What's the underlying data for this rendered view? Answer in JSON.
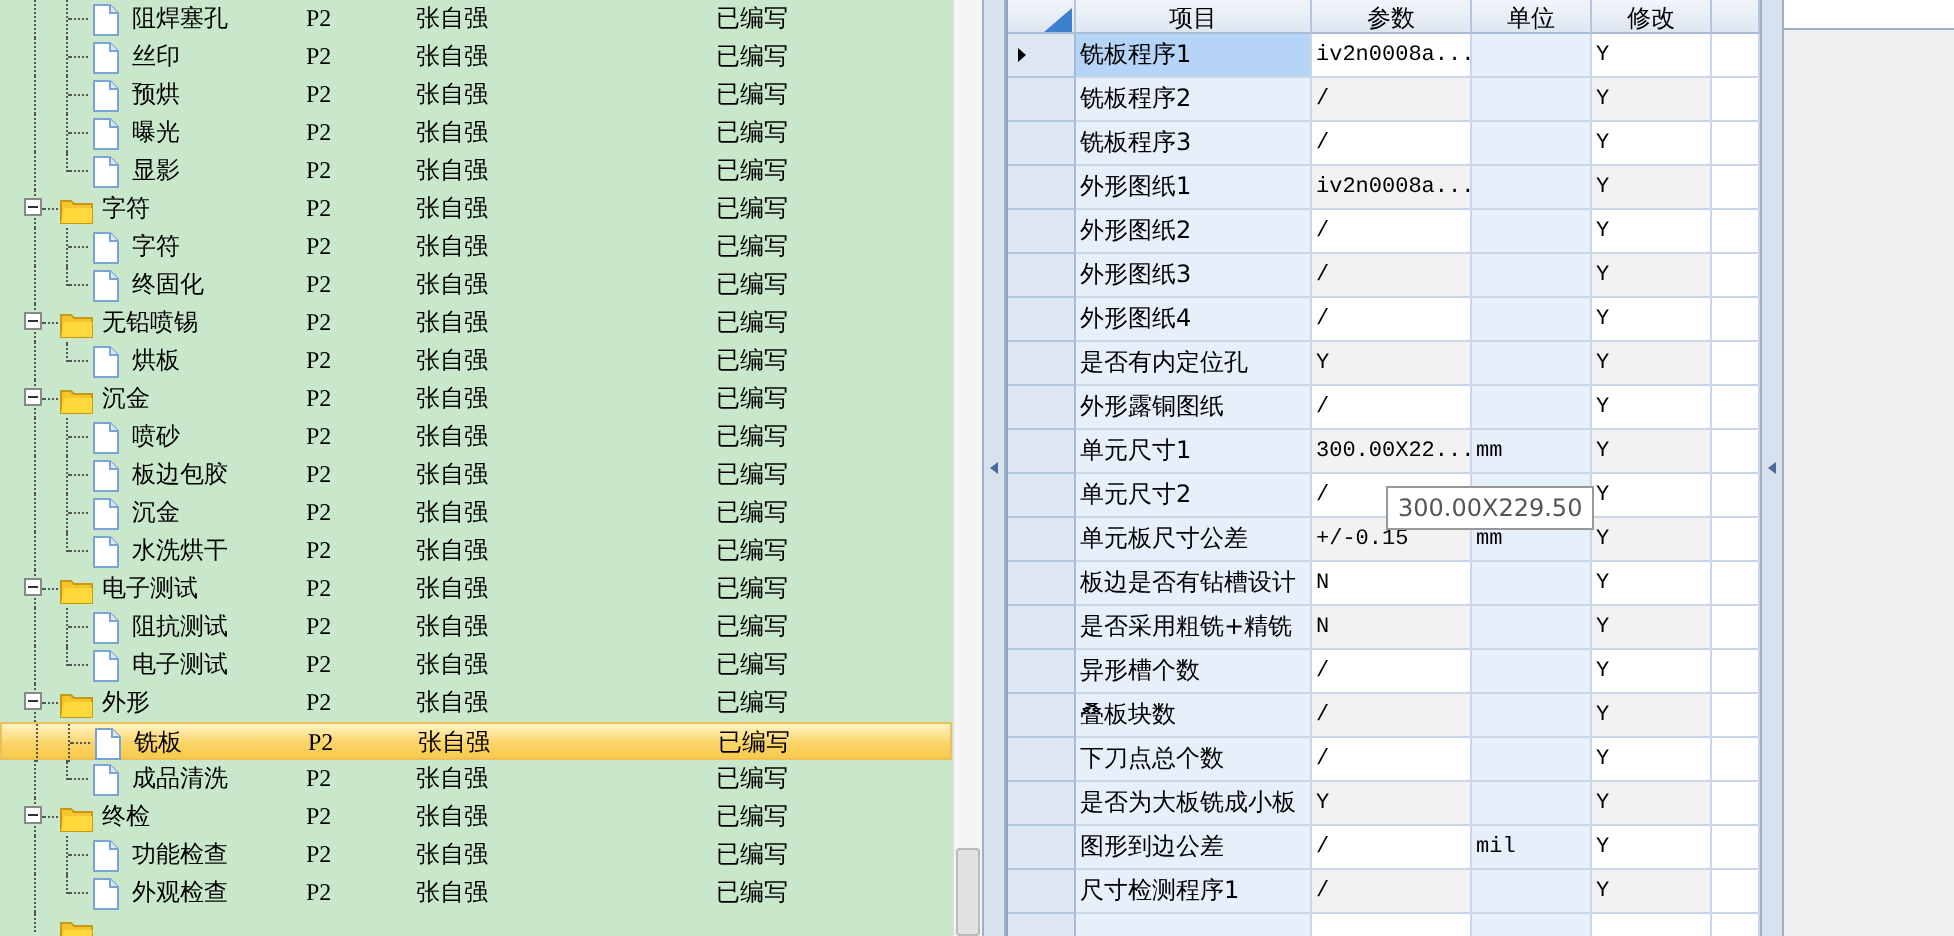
{
  "tree": [
    {
      "children": [
        {
          "kind": "file",
          "label": "阻焊塞孔",
          "level": "P2",
          "person": "张自强",
          "status": "已编写",
          "selected": false
        },
        {
          "kind": "file",
          "label": "丝印",
          "level": "P2",
          "person": "张自强",
          "status": "已编写",
          "selected": false
        },
        {
          "kind": "file",
          "label": "预烘",
          "level": "P2",
          "person": "张自强",
          "status": "已编写",
          "selected": false
        },
        {
          "kind": "file",
          "label": "曝光",
          "level": "P2",
          "person": "张自强",
          "status": "已编写",
          "selected": false
        },
        {
          "kind": "file",
          "label": "显影",
          "level": "P2",
          "person": "张自强",
          "status": "已编写",
          "selected": false
        }
      ]
    },
    {
      "kind": "folder",
      "label": "字符",
      "level": "P2",
      "person": "张自强",
      "status": "已编写",
      "expanded": true,
      "selected": false,
      "children": [
        {
          "kind": "file",
          "label": "字符",
          "level": "P2",
          "person": "张自强",
          "status": "已编写",
          "selected": false
        },
        {
          "kind": "file",
          "label": "终固化",
          "level": "P2",
          "person": "张自强",
          "status": "已编写",
          "selected": false
        }
      ]
    },
    {
      "kind": "folder",
      "label": "无铅喷锡",
      "level": "P2",
      "person": "张自强",
      "status": "已编写",
      "expanded": true,
      "selected": false,
      "children": [
        {
          "kind": "file",
          "label": "烘板",
          "level": "P2",
          "person": "张自强",
          "status": "已编写",
          "selected": false
        }
      ]
    },
    {
      "kind": "folder",
      "label": "沉金",
      "level": "P2",
      "person": "张自强",
      "status": "已编写",
      "expanded": true,
      "selected": false,
      "children": [
        {
          "kind": "file",
          "label": "喷砂",
          "level": "P2",
          "person": "张自强",
          "status": "已编写",
          "selected": false
        },
        {
          "kind": "file",
          "label": "板边包胶",
          "level": "P2",
          "person": "张自强",
          "status": "已编写",
          "selected": false
        },
        {
          "kind": "file",
          "label": "沉金",
          "level": "P2",
          "person": "张自强",
          "status": "已编写",
          "selected": false
        },
        {
          "kind": "file",
          "label": "水洗烘干",
          "level": "P2",
          "person": "张自强",
          "status": "已编写",
          "selected": false
        }
      ]
    },
    {
      "kind": "folder",
      "label": "电子测试",
      "level": "P2",
      "person": "张自强",
      "status": "已编写",
      "expanded": true,
      "selected": false,
      "children": [
        {
          "kind": "file",
          "label": "阻抗测试",
          "level": "P2",
          "person": "张自强",
          "status": "已编写",
          "selected": false
        },
        {
          "kind": "file",
          "label": "电子测试",
          "level": "P2",
          "person": "张自强",
          "status": "已编写",
          "selected": false
        }
      ]
    },
    {
      "kind": "folder",
      "label": "外形",
      "level": "P2",
      "person": "张自强",
      "status": "已编写",
      "expanded": true,
      "selected": false,
      "children": [
        {
          "kind": "file",
          "label": "铣板",
          "level": "P2",
          "person": "张自强",
          "status": "已编写",
          "selected": true
        },
        {
          "kind": "file",
          "label": "成品清洗",
          "level": "P2",
          "person": "张自强",
          "status": "已编写",
          "selected": false
        }
      ]
    },
    {
      "kind": "folder",
      "label": "终检",
      "level": "P2",
      "person": "张自强",
      "status": "已编写",
      "expanded": true,
      "selected": false,
      "children": [
        {
          "kind": "file",
          "label": "功能检查",
          "level": "P2",
          "person": "张自强",
          "status": "已编写",
          "selected": false
        },
        {
          "kind": "file",
          "label": "外观检查",
          "level": "P2",
          "person": "张自强",
          "status": "已编写",
          "selected": false
        }
      ]
    }
  ],
  "grid": {
    "columns": [
      "项目",
      "参数",
      "单位",
      "修改"
    ],
    "rows": [
      {
        "item": "铣板程序1",
        "param": "iv2n0008a...",
        "unit": "",
        "modify": "Y",
        "selected": true
      },
      {
        "item": "铣板程序2",
        "param": "/",
        "unit": "",
        "modify": "Y",
        "selected": false
      },
      {
        "item": "铣板程序3",
        "param": "/",
        "unit": "",
        "modify": "Y",
        "selected": false
      },
      {
        "item": "外形图纸1",
        "param": "iv2n0008a...",
        "unit": "",
        "modify": "Y",
        "selected": false
      },
      {
        "item": "外形图纸2",
        "param": "/",
        "unit": "",
        "modify": "Y",
        "selected": false
      },
      {
        "item": "外形图纸3",
        "param": "/",
        "unit": "",
        "modify": "Y",
        "selected": false
      },
      {
        "item": "外形图纸4",
        "param": "/",
        "unit": "",
        "modify": "Y",
        "selected": false
      },
      {
        "item": "是否有内定位孔",
        "param": "Y",
        "unit": "",
        "modify": "Y",
        "selected": false
      },
      {
        "item": "外形露铜图纸",
        "param": "/",
        "unit": "",
        "modify": "Y",
        "selected": false
      },
      {
        "item": "单元尺寸1",
        "param": "300.00X22...",
        "unit": "mm",
        "modify": "Y",
        "selected": false
      },
      {
        "item": "单元尺寸2",
        "param": "/",
        "unit": "",
        "modify": "Y",
        "selected": false
      },
      {
        "item": "单元板尺寸公差",
        "param": "+/-0.15",
        "unit": "mm",
        "modify": "Y",
        "selected": false
      },
      {
        "item": "板边是否有钻槽设计",
        "param": "N",
        "unit": "",
        "modify": "Y",
        "selected": false
      },
      {
        "item": "是否采用粗铣+精铣",
        "param": "N",
        "unit": "",
        "modify": "Y",
        "selected": false
      },
      {
        "item": "异形槽个数",
        "param": "/",
        "unit": "",
        "modify": "Y",
        "selected": false
      },
      {
        "item": "叠板块数",
        "param": "/",
        "unit": "",
        "modify": "Y",
        "selected": false
      },
      {
        "item": "下刀点总个数",
        "param": "/",
        "unit": "",
        "modify": "Y",
        "selected": false
      },
      {
        "item": "是否为大板铣成小板",
        "param": "Y",
        "unit": "",
        "modify": "Y",
        "selected": false
      },
      {
        "item": "图形到边公差",
        "param": "/",
        "unit": "mil",
        "modify": "Y",
        "selected": false
      },
      {
        "item": "尺寸检测程序1",
        "param": "/",
        "unit": "",
        "modify": "Y",
        "selected": false
      }
    ]
  },
  "tooltip": "300.00X229.50"
}
